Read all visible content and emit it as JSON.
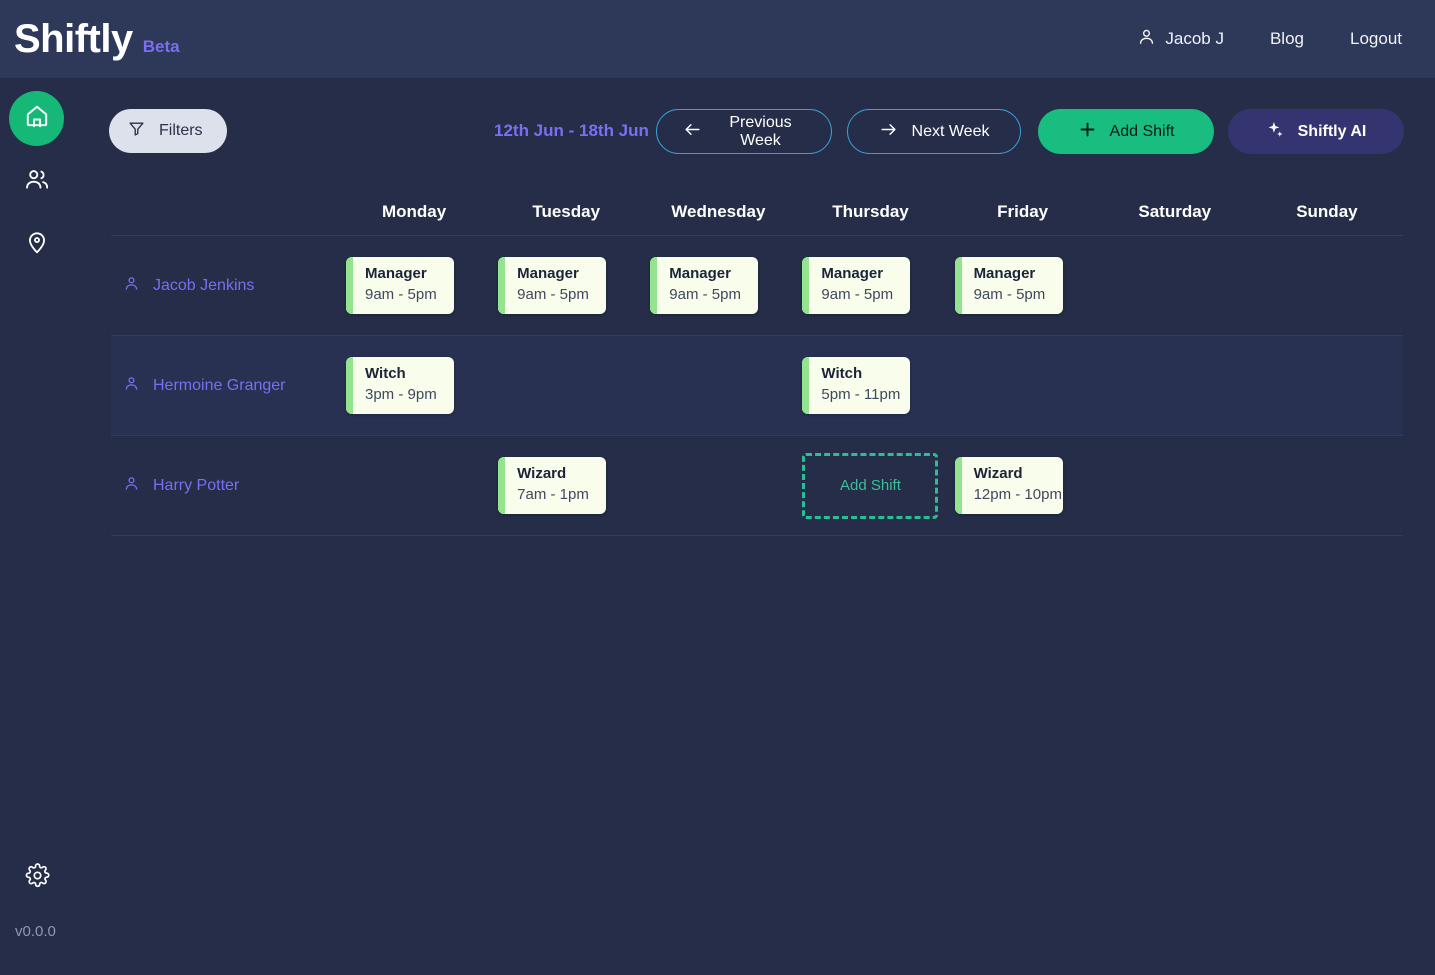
{
  "header": {
    "brand_name": "Shiftly",
    "brand_badge": "Beta",
    "nav": [
      {
        "label": "Jacob J",
        "icon": "user-icon"
      },
      {
        "label": "Blog",
        "icon": ""
      },
      {
        "label": "Logout",
        "icon": ""
      }
    ]
  },
  "sidebar": {
    "items": [
      {
        "icon": "home-icon",
        "name": "home"
      },
      {
        "icon": "people-icon",
        "name": "people"
      },
      {
        "icon": "location-pin-icon",
        "name": "locations"
      }
    ],
    "settings_icon": "gear-icon",
    "version": "v0.0.0"
  },
  "toolbar": {
    "filters_label": "Filters",
    "filters_icon": "funnel-icon",
    "date_range": "12th Jun - 18th Jun",
    "previous_week_label": "Previous Week",
    "previous_week_icon": "arrow-left-icon",
    "next_week_label": "Next Week",
    "next_week_icon": "arrow-right-icon",
    "add_shift_label": "Add Shift",
    "add_shift_icon": "plus-icon",
    "ai_label": "Shiftly AI",
    "ai_icon": "sparkles-icon"
  },
  "schedule": {
    "days": [
      "Monday",
      "Tuesday",
      "Wednesday",
      "Thursday",
      "Friday",
      "Saturday",
      "Sunday"
    ],
    "add_shift_slot_label": "Add Shift",
    "rows": [
      {
        "employee": "Jacob Jenkins",
        "shifts": [
          {
            "role": "Manager",
            "time": "9am - 5pm"
          },
          {
            "role": "Manager",
            "time": "9am - 5pm"
          },
          {
            "role": "Manager",
            "time": "9am - 5pm"
          },
          {
            "role": "Manager",
            "time": "9am - 5pm"
          },
          {
            "role": "Manager",
            "time": "9am - 5pm"
          },
          null,
          null
        ]
      },
      {
        "employee": "Hermoine Granger",
        "shifts": [
          {
            "role": "Witch",
            "time": "3pm - 9pm"
          },
          null,
          null,
          {
            "role": "Witch",
            "time": "5pm - 11pm"
          },
          null,
          null,
          null
        ]
      },
      {
        "employee": "Harry Potter",
        "shifts": [
          null,
          {
            "role": "Wizard",
            "time": "7am - 1pm"
          },
          null,
          {
            "placeholder": true
          },
          {
            "role": "Wizard",
            "time": "12pm - 10pm"
          },
          null,
          null
        ]
      }
    ]
  },
  "colors": {
    "background": "#252d48",
    "header_bg": "#2e3859",
    "accent_green": "#18bd7f",
    "accent_purple": "#7c6ef0",
    "card_bg": "#f9fdec",
    "card_accent": "#94e48f",
    "outline_blue": "#3a9fd8",
    "ai_bg": "#333470"
  }
}
